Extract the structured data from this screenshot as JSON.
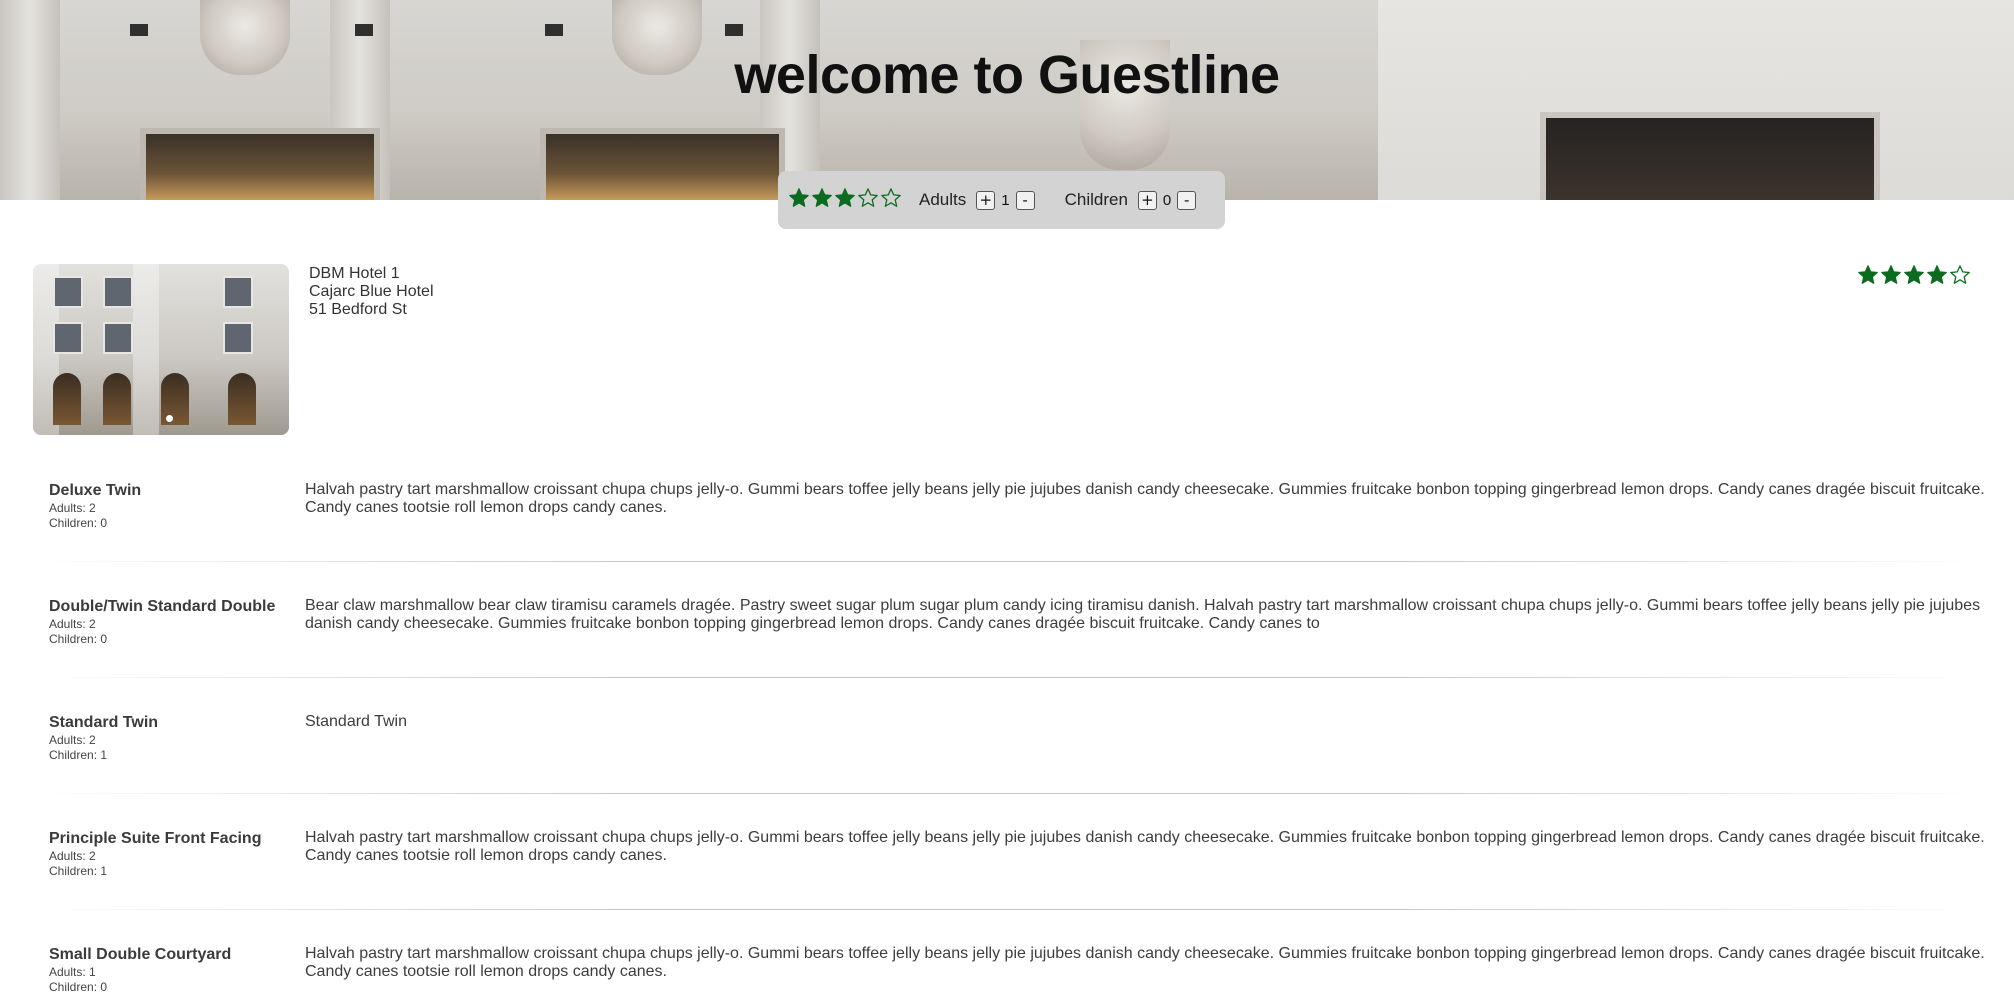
{
  "header": {
    "title": "welcome to Guestline"
  },
  "filter": {
    "rating": 3,
    "max_rating": 5,
    "adults_label": "Adults",
    "adults_value": "1",
    "children_label": "Children",
    "children_value": "0",
    "plus_label": "+",
    "minus_label": "-"
  },
  "hotel": {
    "name": "DBM Hotel 1",
    "address1": "Cajarc Blue Hotel",
    "address2": "51 Bedford St",
    "rating": 4,
    "max_rating": 5
  },
  "colors": {
    "star": "#0b6b1e",
    "filter_bg": "#d3d3d3"
  },
  "rooms": [
    {
      "name": "Deluxe Twin",
      "adults": "Adults: 2",
      "children": "Children: 0",
      "description": "Halvah pastry tart marshmallow croissant chupa chups jelly-o. Gummi bears toffee jelly beans jelly pie jujubes danish candy cheesecake. Gummies fruitcake bonbon topping gingerbread lemon drops. Candy canes dragée biscuit fruitcake. Candy canes tootsie roll lemon drops candy canes."
    },
    {
      "name": "Double/Twin Standard Double",
      "adults": "Adults: 2",
      "children": "Children: 0",
      "description": "Bear claw marshmallow bear claw tiramisu caramels dragée. Pastry sweet sugar plum sugar plum candy icing tiramisu danish. Halvah pastry tart marshmallow croissant chupa chups jelly-o. Gummi bears toffee jelly beans jelly pie jujubes danish candy cheesecake. Gummies fruitcake bonbon topping gingerbread lemon drops. Candy canes dragée biscuit fruitcake. Candy canes to"
    },
    {
      "name": "Standard Twin",
      "adults": "Adults: 2",
      "children": "Children: 1",
      "description": "Standard Twin"
    },
    {
      "name": "Principle Suite Front Facing",
      "adults": "Adults: 2",
      "children": "Children: 1",
      "description": "Halvah pastry tart marshmallow croissant chupa chups jelly-o. Gummi bears toffee jelly beans jelly pie jujubes danish candy cheesecake. Gummies fruitcake bonbon topping gingerbread lemon drops. Candy canes dragée biscuit fruitcake. Candy canes tootsie roll lemon drops candy canes."
    },
    {
      "name": "Small Double Courtyard",
      "adults": "Adults: 1",
      "children": "Children: 0",
      "description": "Halvah pastry tart marshmallow croissant chupa chups jelly-o. Gummi bears toffee jelly beans jelly pie jujubes danish candy cheesecake. Gummies fruitcake bonbon topping gingerbread lemon drops. Candy canes dragée biscuit fruitcake. Candy canes tootsie roll lemon drops candy canes."
    }
  ]
}
